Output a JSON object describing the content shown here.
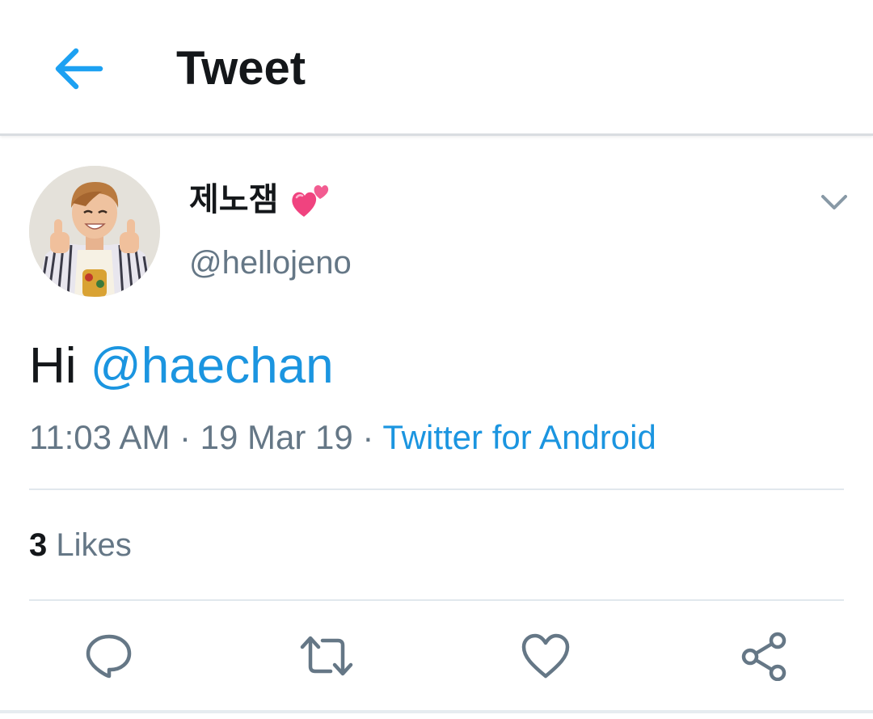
{
  "app_bar": {
    "title": "Tweet",
    "back_icon": "arrow-left-icon",
    "accent_color": "#1da1f2"
  },
  "tweet": {
    "author": {
      "display_name": "제노잼",
      "name_emoji": "two-hearts-emoji",
      "handle": "@hellojeno"
    },
    "text_prefix": "Hi ",
    "mention": "@haechan",
    "timestamp": "11:03 AM · 19 Mar 19 · ",
    "source": "Twitter for Android",
    "likes_count": "3",
    "likes_label": " Likes",
    "link_color": "#1b95e0"
  },
  "actions": [
    {
      "name": "reply",
      "icon": "reply-icon"
    },
    {
      "name": "retweet",
      "icon": "retweet-icon"
    },
    {
      "name": "like",
      "icon": "heart-icon"
    },
    {
      "name": "share",
      "icon": "share-icon"
    }
  ]
}
